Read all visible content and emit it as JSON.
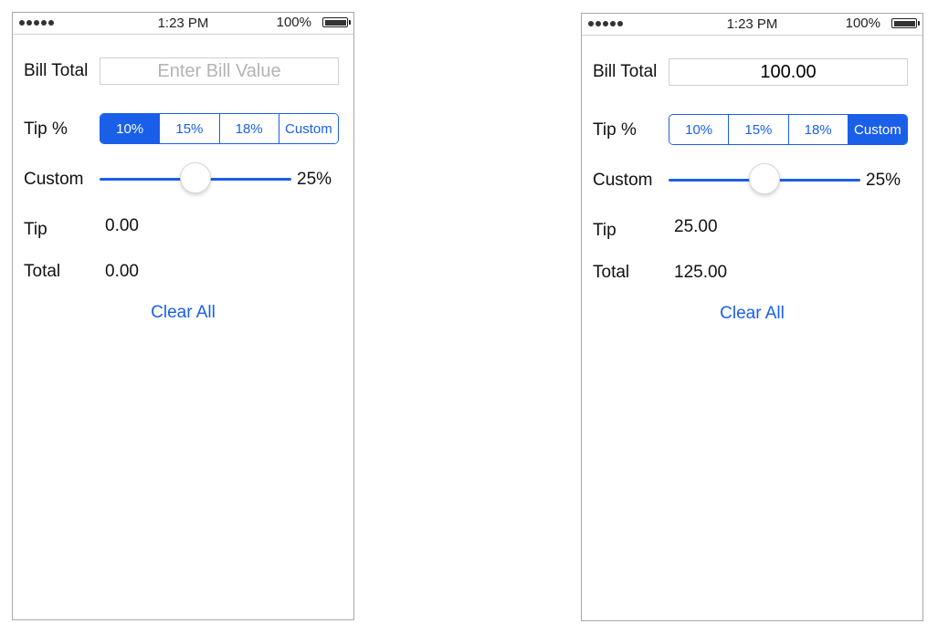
{
  "screens": [
    {
      "status": {
        "time": "1:23 PM",
        "battery": "100%"
      },
      "bill_label": "Bill Total",
      "bill_value": "",
      "bill_placeholder": "Enter Bill Value",
      "tip_label": "Tip %",
      "tip_options": [
        "10%",
        "15%",
        "18%",
        "Custom"
      ],
      "tip_selected": "10%",
      "custom_label": "Custom",
      "custom_value": "25%",
      "custom_fraction": 0.5,
      "tip_row_label": "Tip",
      "tip_amount": "0.00",
      "total_label": "Total",
      "total_amount": "0.00",
      "clear_label": "Clear All"
    },
    {
      "status": {
        "time": "1:23 PM",
        "battery": "100%"
      },
      "bill_label": "Bill Total",
      "bill_value": "100.00",
      "bill_placeholder": "",
      "tip_label": "Tip %",
      "tip_options": [
        "10%",
        "15%",
        "18%",
        "Custom"
      ],
      "tip_selected": "Custom",
      "custom_label": "Custom",
      "custom_value": "25%",
      "custom_fraction": 0.5,
      "tip_row_label": "Tip",
      "tip_amount": "25.00",
      "total_label": "Total",
      "total_amount": "125.00",
      "clear_label": "Clear All"
    }
  ],
  "colors": {
    "accent": "#1a5fe8",
    "border": "#a8a8a8",
    "placeholder": "#b3b3b3"
  }
}
